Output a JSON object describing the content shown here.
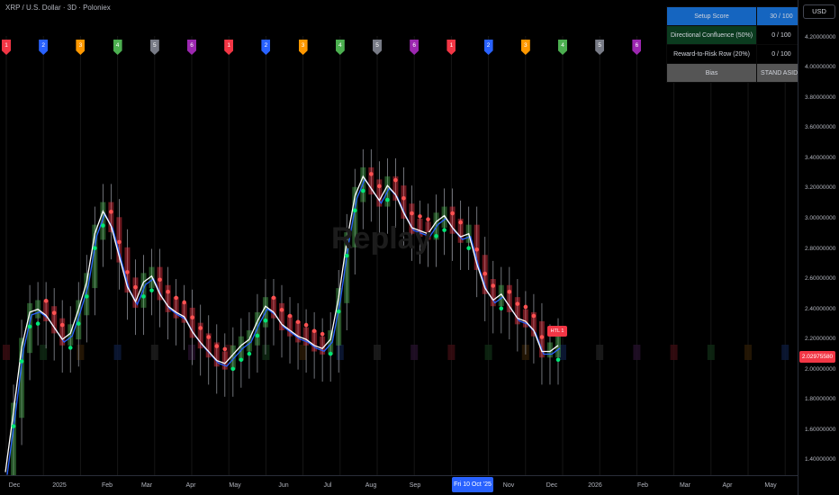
{
  "title": "XRP / U.S. Dollar · 3D · Poloniex",
  "watermark": "Replay",
  "currency": "USD",
  "last_price": "2.02975580",
  "high_low_label": "HTL 1",
  "score_table": [
    {
      "label": "Setup Score",
      "value": "30 / 100",
      "label_color": "#1565c0",
      "value_color": "#1565c0"
    },
    {
      "label": "Directional Confluence (50%)",
      "value": "0 / 100",
      "label_color": "#0b3b1f",
      "value_color": "#000000"
    },
    {
      "label": "Reward-to-Risk Row (20%)",
      "value": "0 / 100",
      "label_color": "#000000",
      "value_color": "#000000"
    },
    {
      "label": "Bias",
      "value": "STAND ASIDE",
      "label_color": "#555555",
      "value_color": "#555555"
    }
  ],
  "cycle_markers": [
    {
      "label": "1",
      "color": "#f23645"
    },
    {
      "label": "2",
      "color": "#2962ff"
    },
    {
      "label": "3",
      "color": "#ff9800"
    },
    {
      "label": "4",
      "color": "#4caf50"
    },
    {
      "label": "5",
      "color": "#787b86"
    },
    {
      "label": "6",
      "color": "#9c27b0"
    },
    {
      "label": "1",
      "color": "#f23645"
    },
    {
      "label": "2",
      "color": "#2962ff"
    },
    {
      "label": "3",
      "color": "#ff9800"
    },
    {
      "label": "4",
      "color": "#4caf50"
    },
    {
      "label": "5",
      "color": "#787b86"
    },
    {
      "label": "6",
      "color": "#9c27b0"
    },
    {
      "label": "1",
      "color": "#f23645"
    },
    {
      "label": "2",
      "color": "#2962ff"
    },
    {
      "label": "3",
      "color": "#ff9800"
    },
    {
      "label": "4",
      "color": "#4caf50"
    },
    {
      "label": "5",
      "color": "#787b86"
    },
    {
      "label": "6",
      "color": "#9c27b0"
    },
    {
      "label": "1",
      "color": "#f23645"
    },
    {
      "label": "2",
      "color": "#2962ff"
    },
    {
      "label": "3",
      "color": "#ff9800"
    },
    {
      "label": "4",
      "color": "#4caf50"
    }
  ],
  "chart_data": {
    "type": "line",
    "title": "XRP / U.S. Dollar · 3D · Poloniex",
    "xlabel": "",
    "ylabel": "",
    "ylim": [
      1.3,
      4.3
    ],
    "yticks": [
      "4.20000000",
      "4.00000000",
      "3.80000000",
      "3.60000000",
      "3.40000000",
      "3.20000000",
      "3.00000000",
      "2.80000000",
      "2.60000000",
      "2.40000000",
      "2.20000000",
      "2.00000000",
      "1.80000000",
      "1.60000000",
      "1.40000000"
    ],
    "xticks": [
      "Dec",
      "2025",
      "Feb",
      "Mar",
      "Apr",
      "May",
      "Jun",
      "Jul",
      "Aug",
      "Sep",
      "Fri 10 Oct '25",
      "Nov",
      "Dec",
      "2026",
      "Feb",
      "Mar",
      "Apr",
      "May"
    ],
    "highlighted_xtick": "Fri 10 Oct '25",
    "series": [
      {
        "values": [
          1.32,
          1.72,
          2.15,
          2.38,
          2.4,
          2.36,
          2.28,
          2.2,
          2.24,
          2.4,
          2.58,
          2.9,
          3.05,
          2.95,
          2.75,
          2.55,
          2.45,
          2.58,
          2.62,
          2.5,
          2.42,
          2.38,
          2.35,
          2.25,
          2.18,
          2.12,
          2.06,
          2.04,
          2.1,
          2.16,
          2.2,
          2.32,
          2.42,
          2.38,
          2.3,
          2.26,
          2.22,
          2.2,
          2.16,
          2.14,
          2.2,
          2.48,
          2.85,
          3.15,
          3.28,
          3.2,
          3.12,
          3.22,
          3.16,
          3.04,
          2.94,
          2.92,
          2.9,
          2.98,
          3.02,
          2.94,
          2.88,
          2.9,
          2.7,
          2.54,
          2.46,
          2.5,
          2.42,
          2.34,
          2.32,
          2.26,
          2.12,
          2.12,
          2.16
        ],
        "color": "#ffffff"
      }
    ],
    "support_dots_color": "#00e676",
    "resistance_dots_color": "#ff5252",
    "up_candle_color": "#4caf50",
    "down_candle_color": "#f23645",
    "grid": true
  }
}
